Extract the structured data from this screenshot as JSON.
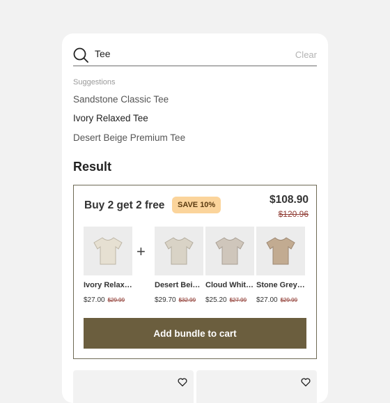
{
  "search": {
    "value": "Tee",
    "clear_label": "Clear"
  },
  "suggestions": {
    "heading": "Suggestions",
    "items": [
      {
        "label": "Sandstone Classic Tee"
      },
      {
        "label": "Ivory Relaxed Tee"
      },
      {
        "label": "Desert Beige Premium Tee"
      }
    ]
  },
  "result": {
    "title": "Result",
    "bundle": {
      "title": "Buy 2 get 2 free",
      "badge": "SAVE 10%",
      "price": "$108.90",
      "old_price": "$120.96",
      "plus": "+",
      "add_label": "Add bundle to cart",
      "products": [
        {
          "name": "Ivory Relaxed Tee",
          "price": "$27.00",
          "old_price": "$29.99",
          "color": "#e6e0d2",
          "icon": "tshirt-icon"
        },
        {
          "name": "Desert Beige Premium Tee",
          "price": "$29.70",
          "old_price": "$32.99",
          "color": "#d9d3c6",
          "icon": "tshirt-icon"
        },
        {
          "name": "Cloud White Tee",
          "price": "$25.20",
          "old_price": "$27.99",
          "color": "#cfc6bb",
          "icon": "tshirt-icon"
        },
        {
          "name": "Stone Grey Tee",
          "price": "$27.00",
          "old_price": "$29.99",
          "color": "#c2ab91",
          "icon": "tshirt-icon"
        }
      ]
    }
  },
  "colors": {
    "accent_button": "#6b5e3e",
    "badge_bg": "#fbd49b",
    "strike_price": "#8f3b33",
    "bundle_border": "#6e6a55"
  }
}
